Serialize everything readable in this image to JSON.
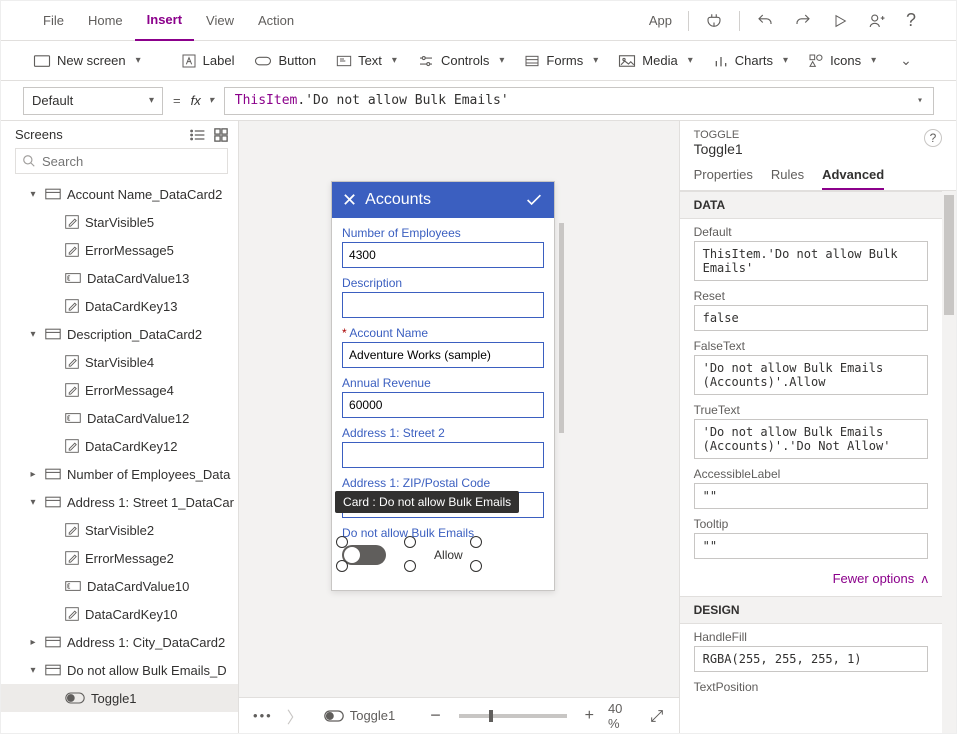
{
  "menu": {
    "file": "File",
    "home": "Home",
    "insert": "Insert",
    "view": "View",
    "action": "Action",
    "app": "App"
  },
  "ribbon": {
    "newscreen": "New screen",
    "label": "Label",
    "button": "Button",
    "text": "Text",
    "controls": "Controls",
    "forms": "Forms",
    "media": "Media",
    "charts": "Charts",
    "icons": "Icons"
  },
  "formula": {
    "prop": "Default",
    "fx": "fx",
    "kw": "ThisItem",
    "rest": ".'Do not allow Bulk Emails'"
  },
  "leftpane": {
    "title": "Screens",
    "search_ph": "Search",
    "nodes": [
      {
        "d": 0,
        "exp": "▾",
        "icon": "card",
        "label": "Account Name_DataCard2"
      },
      {
        "d": 1,
        "icon": "edit",
        "label": "StarVisible5"
      },
      {
        "d": 1,
        "icon": "edit",
        "label": "ErrorMessage5"
      },
      {
        "d": 1,
        "icon": "field",
        "label": "DataCardValue13"
      },
      {
        "d": 1,
        "icon": "edit",
        "label": "DataCardKey13"
      },
      {
        "d": 0,
        "exp": "▾",
        "icon": "card",
        "label": "Description_DataCard2"
      },
      {
        "d": 1,
        "icon": "edit",
        "label": "StarVisible4"
      },
      {
        "d": 1,
        "icon": "edit",
        "label": "ErrorMessage4"
      },
      {
        "d": 1,
        "icon": "field",
        "label": "DataCardValue12"
      },
      {
        "d": 1,
        "icon": "edit",
        "label": "DataCardKey12"
      },
      {
        "d": 0,
        "exp": "▸",
        "icon": "card",
        "label": "Number of Employees_Data"
      },
      {
        "d": 0,
        "exp": "▾",
        "icon": "card",
        "label": "Address 1: Street 1_DataCar"
      },
      {
        "d": 1,
        "icon": "edit",
        "label": "StarVisible2"
      },
      {
        "d": 1,
        "icon": "edit",
        "label": "ErrorMessage2"
      },
      {
        "d": 1,
        "icon": "field",
        "label": "DataCardValue10"
      },
      {
        "d": 1,
        "icon": "edit",
        "label": "DataCardKey10"
      },
      {
        "d": 0,
        "exp": "▸",
        "icon": "card",
        "label": "Address 1: City_DataCard2"
      },
      {
        "d": 0,
        "exp": "▾",
        "icon": "card",
        "label": "Do not allow Bulk Emails_D"
      },
      {
        "d": 1,
        "icon": "toggle",
        "label": "Toggle1",
        "sel": true
      }
    ]
  },
  "phone": {
    "title": "Accounts",
    "cards": [
      {
        "label": "Number of Employees",
        "value": "4300"
      },
      {
        "label": "Description",
        "value": ""
      },
      {
        "label": "Account Name",
        "value": "Adventure Works (sample)",
        "req": true
      },
      {
        "label": "Annual Revenue",
        "value": "60000"
      },
      {
        "label": "Address 1: Street 2",
        "value": ""
      },
      {
        "label": "Address 1: ZIP/Postal Code",
        "value": ""
      }
    ],
    "tooltip": "Card : Do not allow Bulk Emails",
    "toggle_label": "Do not allow Bulk Emails",
    "toggle_text": "Allow"
  },
  "footer": {
    "crumb": "Toggle1",
    "zoom": "40 %"
  },
  "right": {
    "type": "TOGGLE",
    "name": "Toggle1",
    "tabs": {
      "p": "Properties",
      "r": "Rules",
      "a": "Advanced"
    },
    "data_h": "DATA",
    "rows": {
      "default_l": "Default",
      "default_v": "ThisItem.'Do not allow Bulk Emails'",
      "reset_l": "Reset",
      "reset_v": "false",
      "false_l": "FalseText",
      "false_v": "'Do not allow Bulk Emails (Accounts)'.Allow",
      "true_l": "TrueText",
      "true_v": "'Do not allow Bulk Emails (Accounts)'.'Do Not Allow'",
      "acc_l": "AccessibleLabel",
      "acc_v": "\"\"",
      "tip_l": "Tooltip",
      "tip_v": "\"\""
    },
    "fewer": "Fewer options",
    "design_h": "DESIGN",
    "hf_l": "HandleFill",
    "hf_v": "RGBA(255, 255, 255, 1)",
    "tp_l": "TextPosition"
  }
}
